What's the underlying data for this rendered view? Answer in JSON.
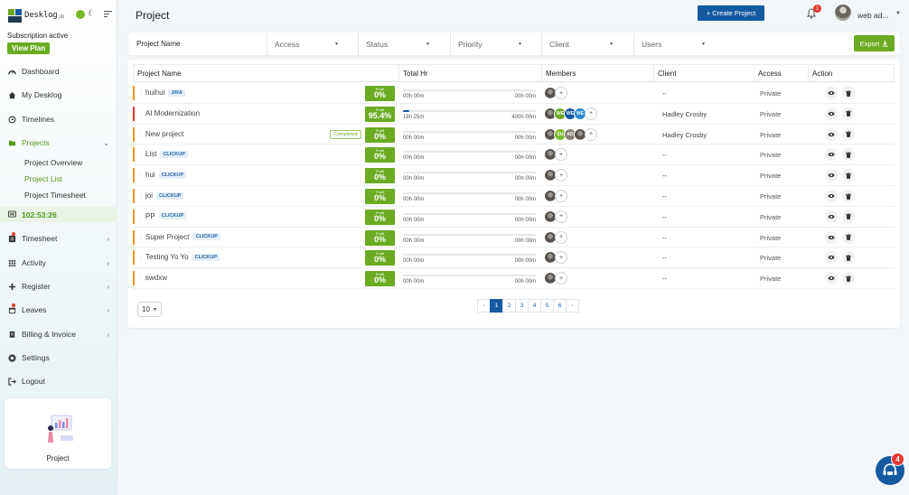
{
  "app": {
    "name": "Desklog",
    "tld": ".io",
    "subscription_status": "Subscription active",
    "view_plan_label": "View Plan"
  },
  "sidebar": {
    "items": [
      {
        "label": "Dashboard",
        "icon": "dashboard-icon"
      },
      {
        "label": "My Desklog",
        "icon": "home-icon"
      },
      {
        "label": "Timelines",
        "icon": "clock-icon"
      },
      {
        "label": "Projects",
        "icon": "folder-icon",
        "active": true
      },
      {
        "label": "Timesheet",
        "icon": "timesheet-icon"
      },
      {
        "label": "Activity",
        "icon": "grid-icon"
      },
      {
        "label": "Register",
        "icon": "plus-icon"
      },
      {
        "label": "Leaves",
        "icon": "calendar-icon"
      },
      {
        "label": "Billing & Invoice",
        "icon": "invoice-icon"
      },
      {
        "label": "Settings",
        "icon": "gear-icon"
      },
      {
        "label": "Logout",
        "icon": "logout-icon"
      }
    ],
    "project_sub": [
      "Project Overview",
      "Project List",
      "Project Timesheet"
    ],
    "timer": "102:53:26",
    "promo_label": "Project"
  },
  "header": {
    "title": "Project",
    "create_label": "+ Create Project",
    "notification_count": "1",
    "user_name": "web ad..."
  },
  "filters": {
    "project_name": "Project Name",
    "access": "Access",
    "status": "Status",
    "priority": "Priority",
    "client": "Client",
    "users": "Users",
    "export_label": "Export"
  },
  "table": {
    "headers": [
      "Project Name",
      "Total Hr",
      "Members",
      "Client",
      "Access",
      "Action"
    ],
    "profit_label": "Profit",
    "rows": [
      {
        "name": "huihui",
        "tag": "JIRA",
        "profit": "0%",
        "hr_left": "00h 00m",
        "hr_right": "00h 00m",
        "progress": 0,
        "members": [],
        "client": "--",
        "access": "Private",
        "color": "#f0952a"
      },
      {
        "name": "AI Modernization",
        "tag": "",
        "profit": "95.4%",
        "hr_left": "18h 25m",
        "hr_right": "400h 00m",
        "progress": 0.046,
        "members": [
          "WE",
          "WE",
          "WE"
        ],
        "client": "Hadley Crosby",
        "access": "Private",
        "color": "#e53935"
      },
      {
        "name": "New project",
        "tag": "",
        "status_chip": "Completed",
        "profit": "0%",
        "hr_left": "00h 00m",
        "hr_right": "00h 00m",
        "progress": 0,
        "members": [
          "SU",
          "AD"
        ],
        "client": "Hadley Crosby",
        "access": "Private",
        "color": "#f0952a"
      },
      {
        "name": "List",
        "tag": "CLICKUP",
        "profit": "0%",
        "hr_left": "00h 00m",
        "hr_right": "00h 00m",
        "progress": 0,
        "members": [],
        "client": "--",
        "access": "Private",
        "color": "#f0952a"
      },
      {
        "name": "hui",
        "tag": "CLICKUP",
        "profit": "0%",
        "hr_left": "00h 00m",
        "hr_right": "00h 00m",
        "progress": 0,
        "members": [],
        "client": "--",
        "access": "Private",
        "color": "#f0952a"
      },
      {
        "name": "joi",
        "tag": "CLICKUP",
        "profit": "0%",
        "hr_left": "00h 00m",
        "hr_right": "00h 00m",
        "progress": 0,
        "members": [],
        "client": "--",
        "access": "Private",
        "color": "#f0952a"
      },
      {
        "name": "PP",
        "tag": "CLICKUP",
        "profit": "0%",
        "hr_left": "00h 00m",
        "hr_right": "00h 00m",
        "progress": 0,
        "members": [],
        "client": "--",
        "access": "Private",
        "color": "#f0952a"
      },
      {
        "name": "Super Project",
        "tag": "CLICKUP",
        "profit": "0%",
        "hr_left": "00h 00m",
        "hr_right": "00h 00m",
        "progress": 0,
        "members": [],
        "client": "--",
        "access": "Private",
        "color": "#f0952a"
      },
      {
        "name": "Testing Yo Yo",
        "tag": "CLICKUP",
        "profit": "0%",
        "hr_left": "00h 00m",
        "hr_right": "00h 00m",
        "progress": 0,
        "members": [],
        "client": "--",
        "access": "Private",
        "color": "#f0952a"
      },
      {
        "name": "swdxw",
        "tag": "",
        "profit": "0%",
        "hr_left": "00h 00m",
        "hr_right": "00h 00m",
        "progress": 0,
        "members": [],
        "client": "--",
        "access": "Private",
        "color": "#f0952a"
      }
    ]
  },
  "pagination": {
    "page_size": "10",
    "prev": "‹",
    "next": "›",
    "pages": [
      "1",
      "2",
      "3",
      "4",
      "5",
      "6"
    ],
    "current": "1"
  },
  "chat": {
    "count": "4"
  },
  "colors": {
    "brand_green": "#6aab22",
    "brand_blue": "#155aa1",
    "alert_red": "#e53935",
    "member_colors": [
      "#6aab22",
      "#155aa1",
      "#2e8bd0",
      "#79b928",
      "#8a7f74"
    ]
  }
}
